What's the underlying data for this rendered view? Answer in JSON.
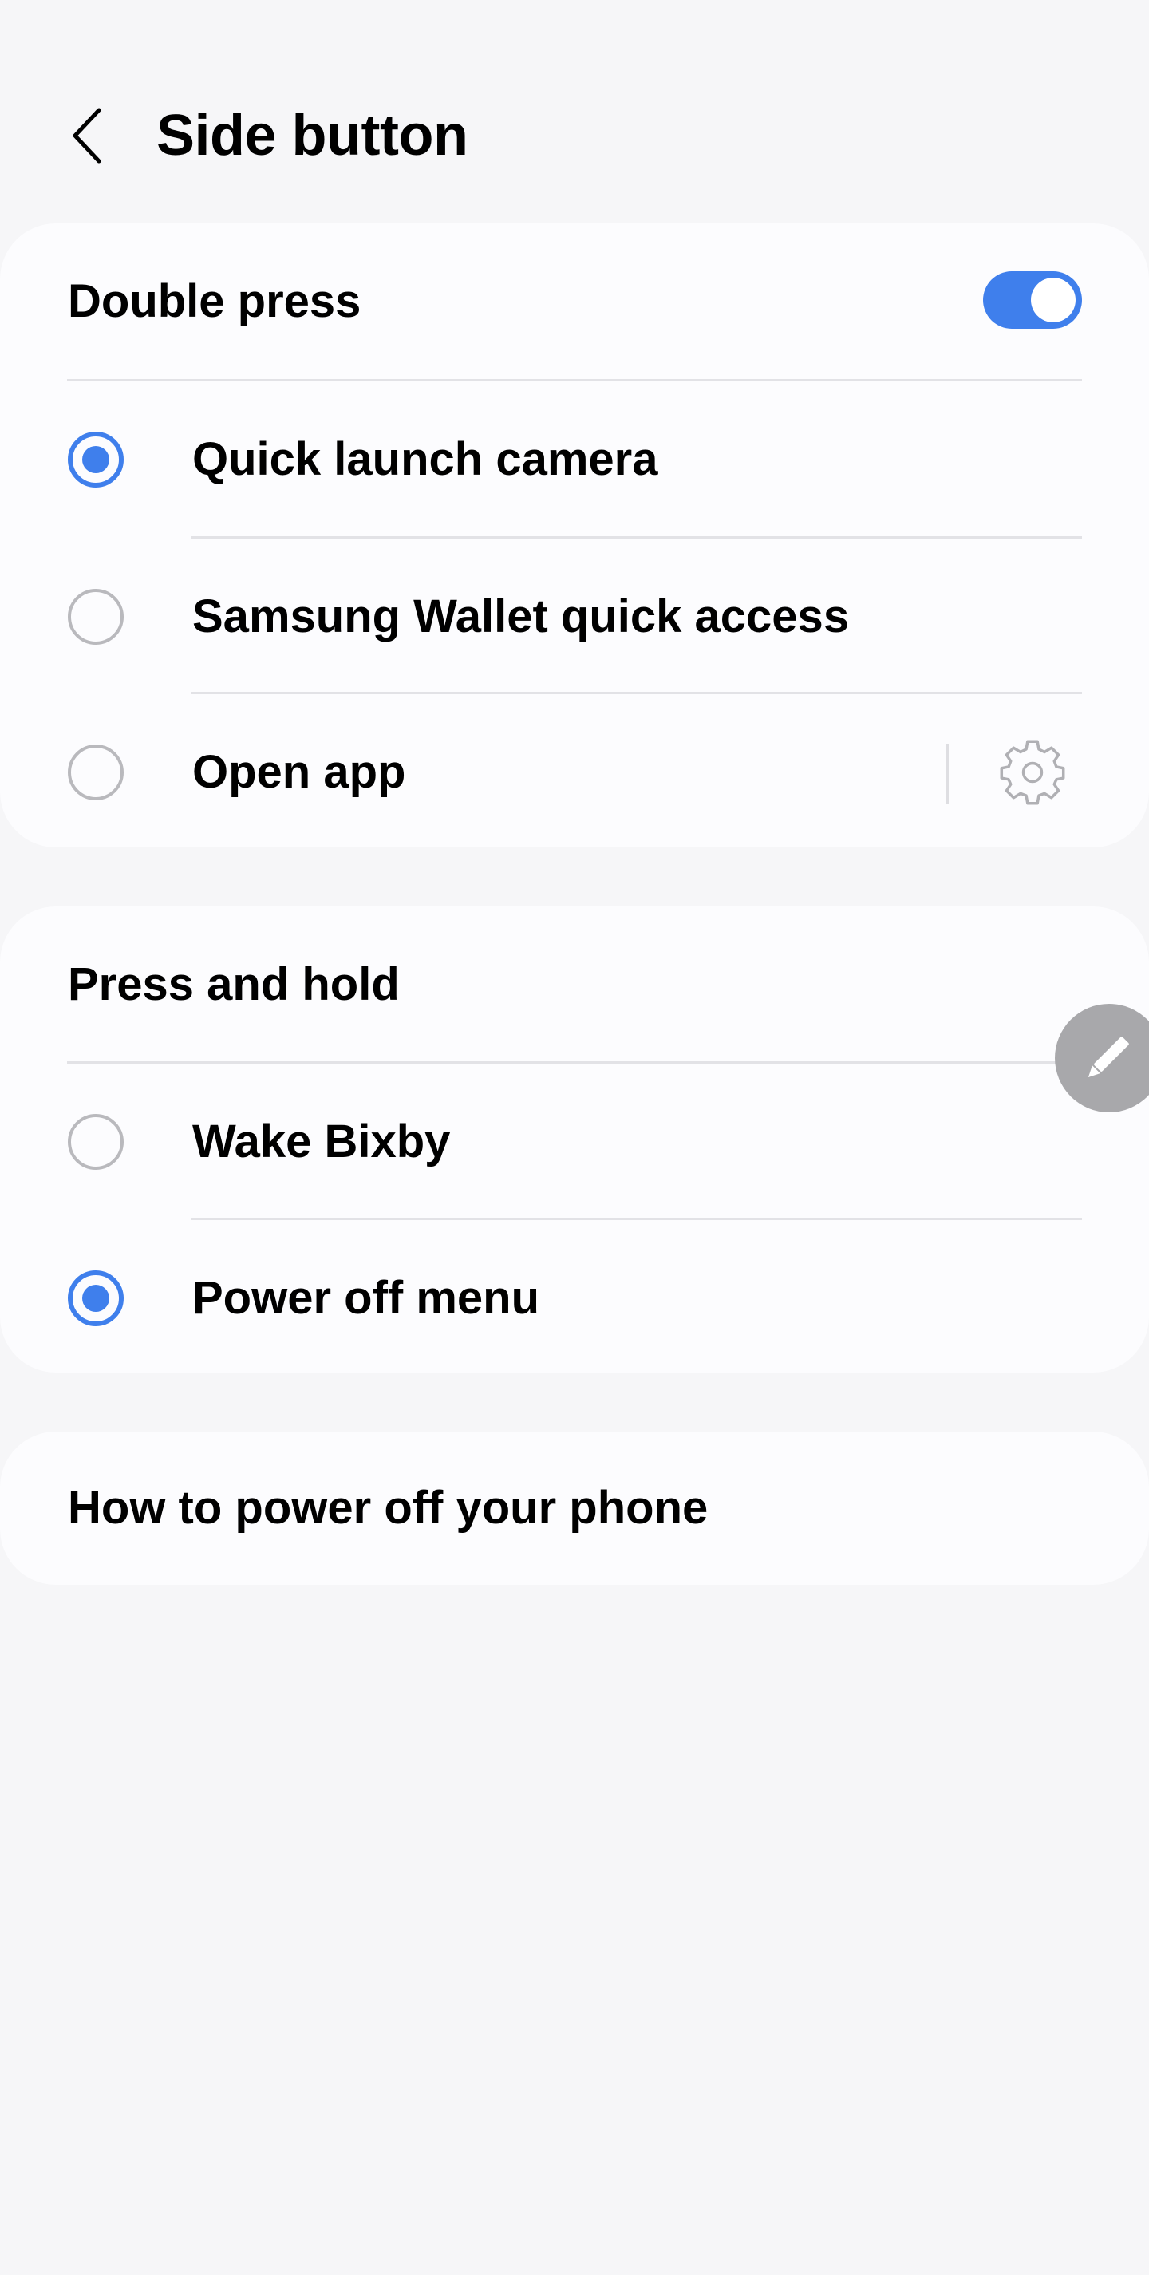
{
  "header": {
    "title": "Side button",
    "back_icon": "chevron-left-icon"
  },
  "double_press": {
    "label": "Double press",
    "enabled": true,
    "options": [
      {
        "label": "Quick launch camera",
        "selected": true
      },
      {
        "label": "Samsung Wallet quick access",
        "selected": false
      },
      {
        "label": "Open app",
        "selected": false,
        "settings_icon": "gear-icon"
      }
    ]
  },
  "press_and_hold": {
    "label": "Press and hold",
    "options": [
      {
        "label": "Wake Bixby",
        "selected": false
      },
      {
        "label": "Power off menu",
        "selected": true
      }
    ]
  },
  "help": {
    "label": "How to power off your phone"
  },
  "floating_button": {
    "icon": "pencil-icon"
  },
  "colors": {
    "accent": "#3f7fec",
    "background": "#f6f6f8",
    "card": "#fcfcfe",
    "divider": "#e2e2e6",
    "radio_off": "#b9b9bd",
    "fab": "#a8a8ab"
  }
}
